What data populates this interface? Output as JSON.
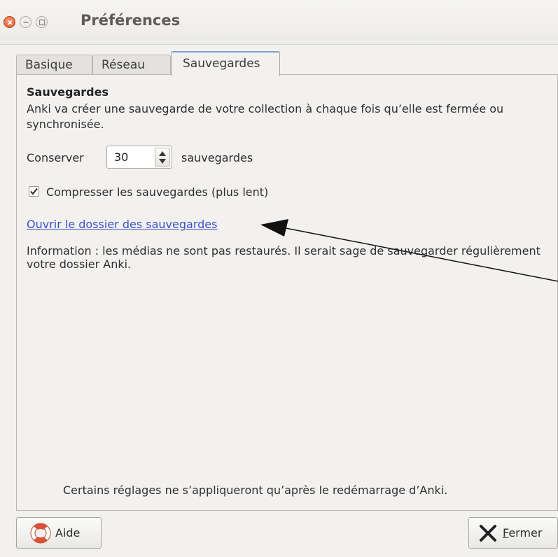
{
  "window": {
    "title": "Préférences"
  },
  "tabs": [
    {
      "label": "Basique"
    },
    {
      "label": "Réseau"
    },
    {
      "label": "Sauvegardes",
      "active": true
    }
  ],
  "backups": {
    "heading": "Sauvegardes",
    "description": "Anki va créer une sauvegarde de votre collection à chaque fois qu’elle est fermée ou synchronisée.",
    "keep_label": "Conserver",
    "keep_value": "30",
    "keep_suffix": "sauvegardes",
    "compress_label": "Compresser les sauvegardes (plus lent)",
    "compress_checked": true,
    "open_folder_link": "Ouvrir le dossier des sauvegardes",
    "info": "Information : les médias ne sont pas restaurés. Il serait sage de sauvegarder régulièrement votre dossier Anki."
  },
  "footer_note": "Certains réglages ne s’appliqueront qu’après le redémarrage d’Anki.",
  "buttons": {
    "help_label": "Aide",
    "close_label_mnemonic": "F",
    "close_label_rest": "ermer"
  },
  "icons": {
    "window_close": "close-icon",
    "window_minimize": "minimize-icon",
    "window_maximize": "maximize-icon",
    "help": "lifebuoy-icon",
    "close_button": "x-icon",
    "checkbox": "checkmark-icon",
    "spin_up": "arrow-up-icon",
    "spin_down": "arrow-down-icon"
  },
  "colors": {
    "link": "#3a52c6",
    "close_button": "#e2592e",
    "active_tab_accent": "#7d9fcb"
  }
}
